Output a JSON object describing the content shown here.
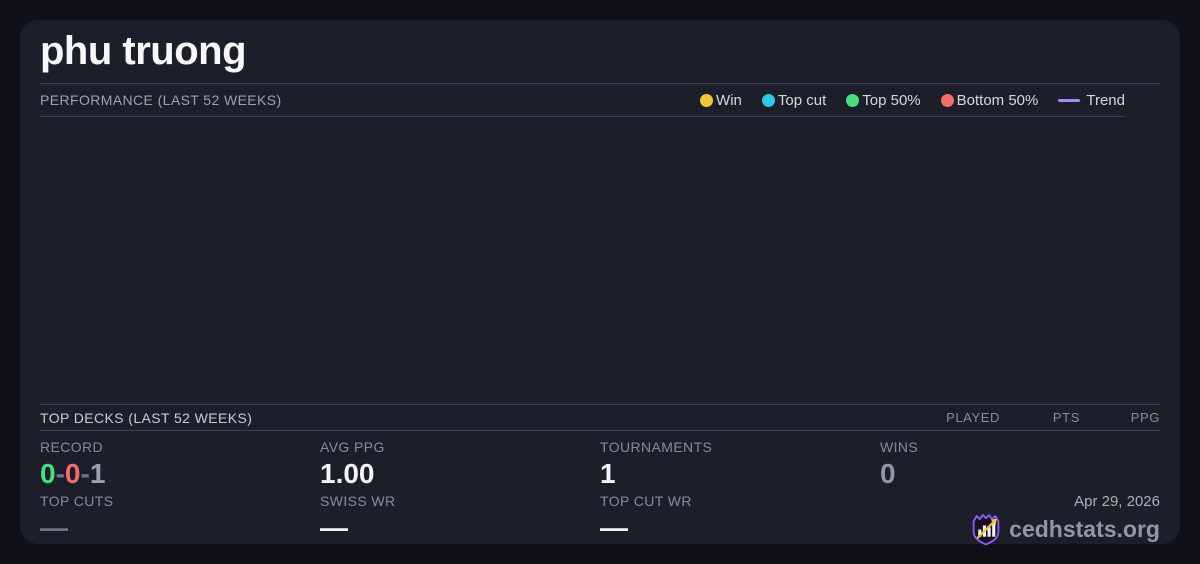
{
  "player": {
    "name": "phu truong"
  },
  "performance": {
    "label": "PERFORMANCE (LAST 52 WEEKS)",
    "legend": [
      {
        "label": "Win",
        "color": "#f2c53d",
        "swatch": "dot"
      },
      {
        "label": "Top cut",
        "color": "#2ec9e8",
        "swatch": "dot"
      },
      {
        "label": "Top 50%",
        "color": "#4ade80",
        "swatch": "dot"
      },
      {
        "label": "Bottom 50%",
        "color": "#f26d6d",
        "swatch": "dot"
      },
      {
        "label": "Trend",
        "color": "#a78bfa",
        "swatch": "line"
      }
    ],
    "chart_points": []
  },
  "top_decks": {
    "label": "TOP DECKS (LAST 52 WEEKS)",
    "columns": [
      "PLAYED",
      "PTS",
      "PPG"
    ],
    "rows": []
  },
  "stats": {
    "record": {
      "label": "RECORD",
      "wins": "0",
      "losses": "0",
      "draws": "1",
      "separator": "-"
    },
    "avg_ppg": {
      "label": "AVG PPG",
      "value": "1.00"
    },
    "tournaments": {
      "label": "TOURNAMENTS",
      "value": "1"
    },
    "wins": {
      "label": "WINS",
      "value": "0"
    },
    "top_cuts": {
      "label": "TOP CUTS",
      "value": "—"
    },
    "swiss_wr": {
      "label": "SWISS WR",
      "value": "—"
    },
    "top_cut_wr": {
      "label": "TOP CUT WR",
      "value": "—"
    }
  },
  "footer": {
    "date": "Apr 29, 2026",
    "brand": "cedhstats.org"
  },
  "colors": {
    "page_background": "#0f1117",
    "card_background": "#1c1f2a",
    "win": "#f2c53d",
    "top_cut": "#2ec9e8",
    "top_50": "#4ade80",
    "bottom_50": "#f26d6d",
    "trend": "#a78bfa",
    "record_win": "#4ade80",
    "record_loss": "#f26d6d",
    "record_draw": "#9aa2b0",
    "brand_purple": "#8b5cf6",
    "brand_gold": "#f2c53d"
  }
}
